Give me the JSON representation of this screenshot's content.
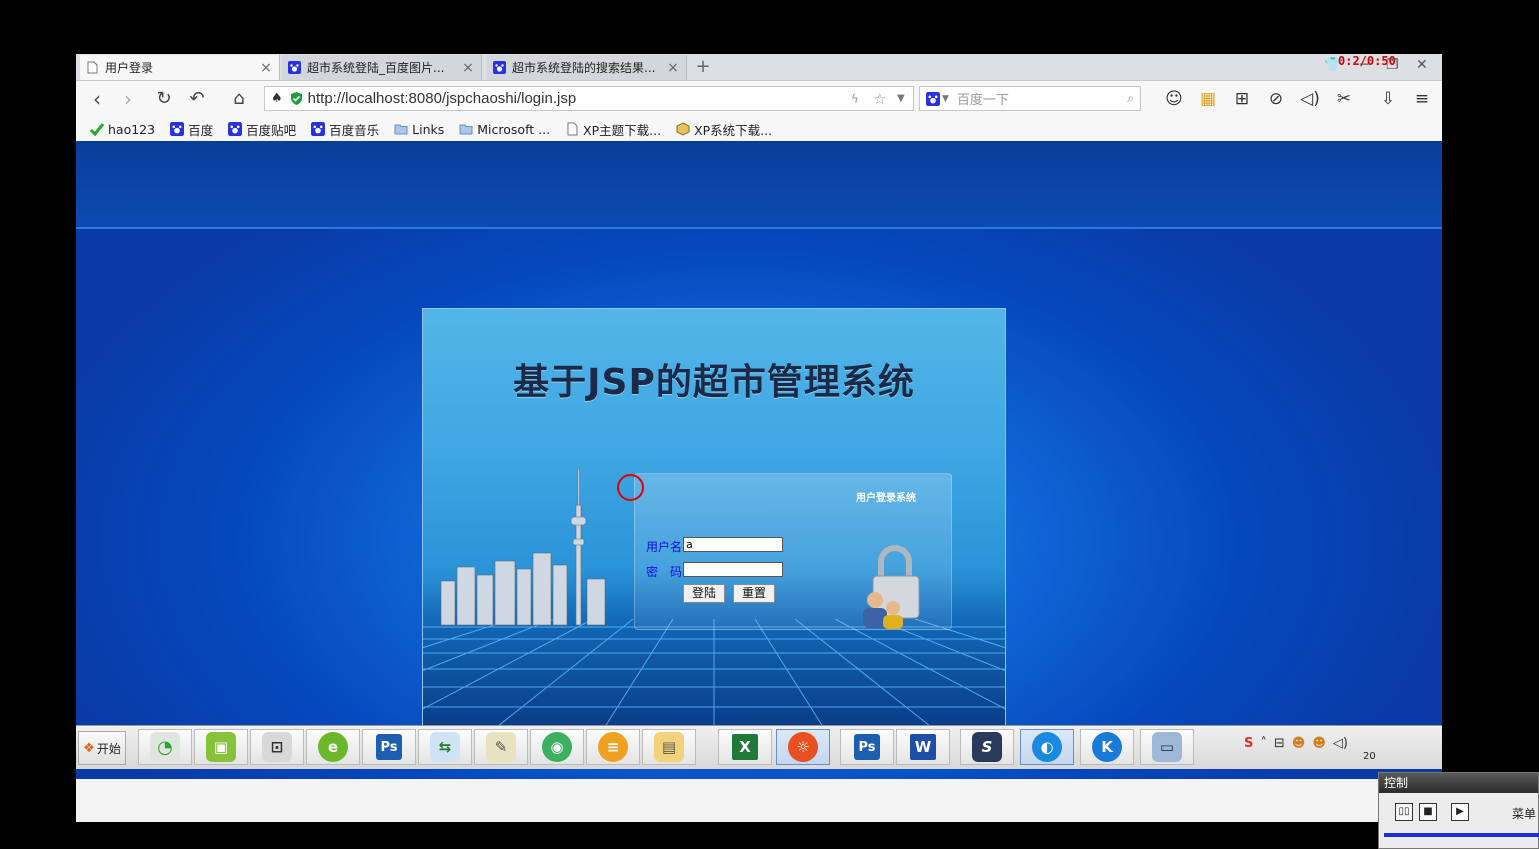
{
  "browser": {
    "tabs": [
      {
        "label": "用户登录",
        "active": true
      },
      {
        "label": "超市系统登陆_百度图片...",
        "active": false
      },
      {
        "label": "超市系统登陆的搜索结果...",
        "active": false
      }
    ],
    "new_tab_symbol": "+",
    "timer": "0:2/0:50",
    "url": "http://localhost:8080/jspchaoshi/login.jsp",
    "search_placeholder": "百度一下",
    "bookmarks": [
      "hao123",
      "百度",
      "百度贴吧",
      "百度音乐",
      "Links",
      "Microsoft ...",
      "XP主题下载...",
      "XP系统下载..."
    ]
  },
  "login": {
    "system_title": "基于JSP的超市管理系统",
    "subtitle": "用户登录系统",
    "username_label": "用户名",
    "username_value": "a",
    "password_label": "密　码",
    "password_value": "",
    "submit_label": "登陆",
    "reset_label": "重置"
  },
  "taskbar": {
    "start_label": "开始",
    "clock_partial": "20"
  },
  "control_window": {
    "title": "控制",
    "menu_label": "菜单"
  },
  "colors": {
    "page_blue": "#0548be",
    "login_label": "#1010e0",
    "timer_red": "#d40000"
  }
}
